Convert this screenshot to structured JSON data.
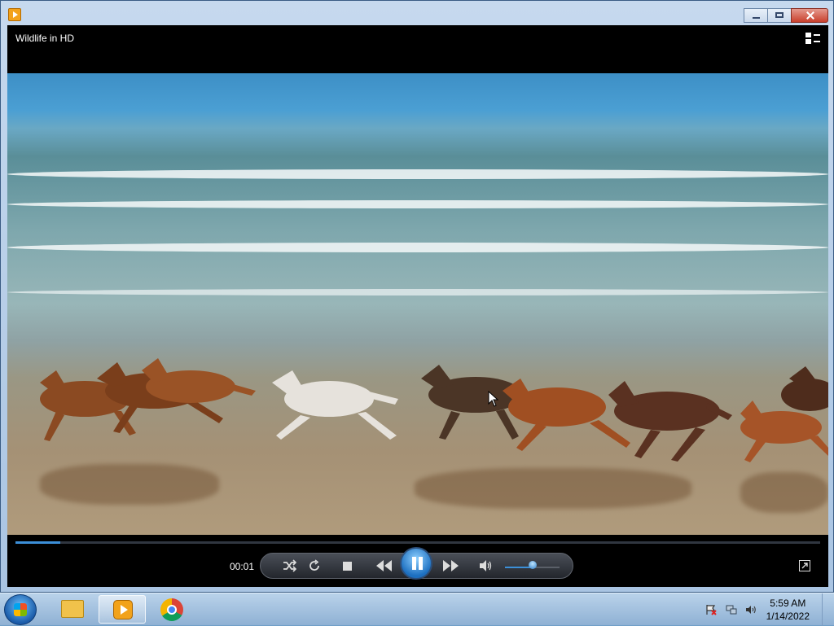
{
  "window": {
    "controls": {
      "minimize": "minimize",
      "maximize": "maximize",
      "close": "close"
    }
  },
  "player": {
    "title": "Wildlife in HD",
    "current_time": "00:01",
    "seek_progress": 0.056,
    "volume_level": 0.5,
    "state": "playing"
  },
  "controls": [
    {
      "name": "shuffle",
      "icon": "shuffle-icon"
    },
    {
      "name": "repeat",
      "icon": "repeat-icon"
    },
    {
      "name": "stop",
      "icon": "stop-icon"
    },
    {
      "name": "previous",
      "icon": "previous-icon"
    },
    {
      "name": "pause",
      "icon": "pause-icon"
    },
    {
      "name": "next",
      "icon": "next-icon"
    },
    {
      "name": "mute",
      "icon": "speaker-icon"
    }
  ],
  "taskbar": {
    "apps": [
      "windows-explorer",
      "windows-media-player",
      "google-chrome"
    ],
    "clock": {
      "time": "5:59 AM",
      "date": "1/14/2022"
    }
  },
  "colors": {
    "accent": "#3c8fd8",
    "close": "#c9402d",
    "player_bg": "#000000"
  }
}
